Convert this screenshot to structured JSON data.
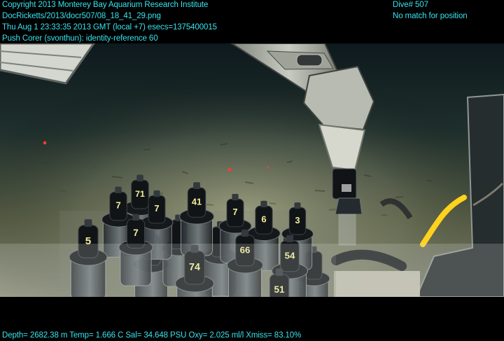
{
  "overlay": {
    "copyright": "Copyright 2013 Monterey Bay Aquarium Research Institute",
    "file": "DocRicketts/2013/docr507/08_18_41_29.png",
    "time": "Thu Aug  1 23:33:35 2013 GMT (local +7)  esecs=1375400015",
    "annotation": "Push Corer (svonthun): identity-reference 60",
    "dive": "Dive# 507",
    "position": "No match for position",
    "sensors": "Depth= 2682.38 m  Temp= 1.666 C  Sal= 34.648 PSU  Oxy= 2.025 ml/l  Xmiss= 83.10%"
  },
  "core_labels": [
    "71",
    "7",
    "41",
    "7",
    "7",
    "7",
    "6",
    "3",
    "5",
    "66",
    "54",
    "74",
    "51"
  ],
  "colors": {
    "overlay_text": "#36e4ef",
    "seafloor": "#7d8068",
    "water": "#17262a",
    "core_tube": "#111417",
    "label_text": "#f3ef9a",
    "hose": "#ffd21d"
  }
}
